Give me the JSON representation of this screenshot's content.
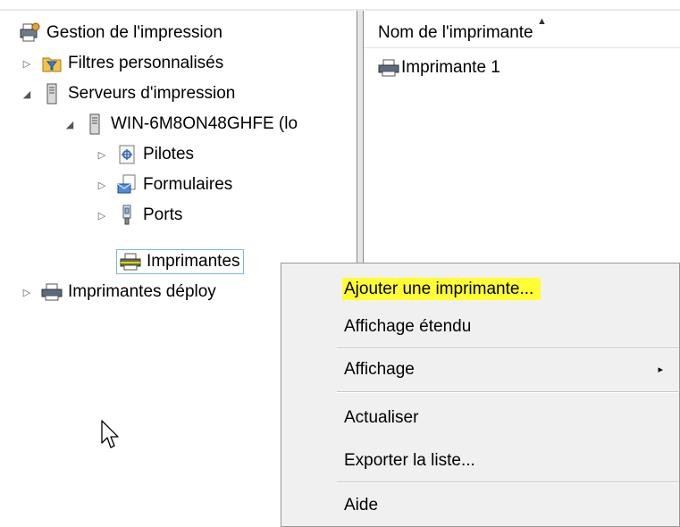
{
  "tree": {
    "root": {
      "label": "Gestion de l'impression",
      "icon": "print-management-icon"
    },
    "items": [
      {
        "label": "Filtres personnalisés",
        "expander": "▷",
        "icon": "filter-folder-icon"
      },
      {
        "label": "Serveurs d'impression",
        "expander": "◢",
        "icon": "server-icon"
      },
      {
        "label": "WIN-6M8ON48GHFE (lo",
        "expander": "◢",
        "icon": "server-icon"
      },
      {
        "label": "Pilotes",
        "expander": "▷",
        "icon": "drivers-icon"
      },
      {
        "label": "Formulaires",
        "expander": "▷",
        "icon": "forms-icon"
      },
      {
        "label": "Ports",
        "expander": "▷",
        "icon": "port-icon"
      },
      {
        "label": "Imprimantes",
        "expander": "",
        "icon": "printer-icon"
      },
      {
        "label": "Imprimantes déploy",
        "expander": "▷",
        "icon": "printer-icon"
      }
    ]
  },
  "list": {
    "column_header": "Nom de l'imprimante",
    "sort_indicator": "▲",
    "rows": [
      {
        "label": "Imprimante 1",
        "icon": "printer-icon"
      }
    ]
  },
  "context_menu": {
    "items": [
      {
        "label": "Ajouter une imprimante...",
        "highlighted": true
      },
      {
        "label": "Affichage étendu"
      },
      {
        "label": "Affichage",
        "submenu_arrow": "▸"
      },
      {
        "label": "Actualiser"
      },
      {
        "label": "Exporter la liste..."
      },
      {
        "label": "Aide"
      }
    ]
  },
  "colors": {
    "highlight": "#ffff33",
    "selection_border": "#7eb4ea",
    "menu_bg": "#f0f0f0"
  }
}
